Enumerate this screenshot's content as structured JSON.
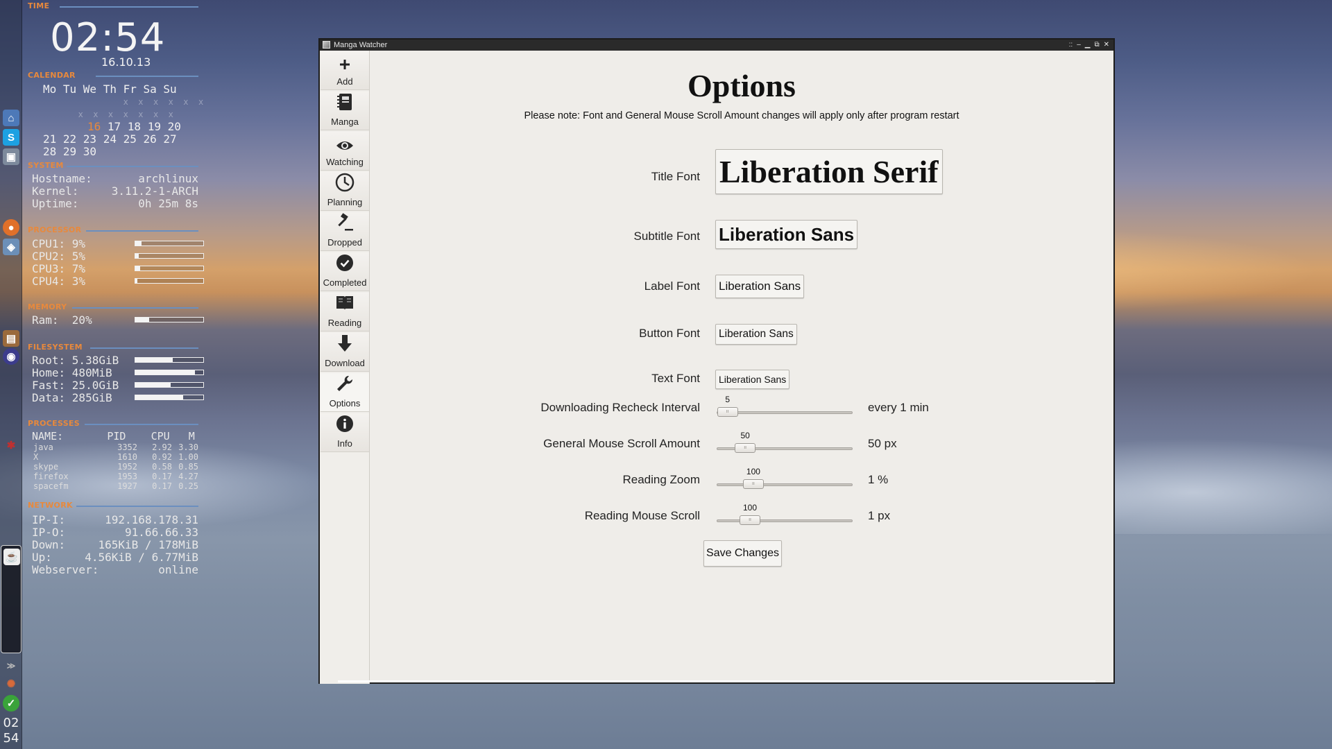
{
  "desktop": {
    "dock_clock": [
      "02",
      "54"
    ],
    "conky": {
      "time_section": "TIME",
      "time": "02:54",
      "date": "16.10.13",
      "calendar_section": "CALENDAR",
      "weekdays": "Mo Tu We Th Fr Sa Su",
      "cal_rows": [
        {
          "dim": "                x  x  x  x  x  x",
          "text": ""
        },
        {
          "dim": "       x  x  x  x  x  x  x",
          "text": ""
        }
      ],
      "cal_week3_today": "16",
      "cal_week3_rest": " 17 18 19 20",
      "cal_week4": "21 22 23 24 25 26 27",
      "cal_week5": "28 29 30",
      "system_section": "SYSTEM",
      "system": [
        {
          "k": "Hostname:",
          "v": "archlinux"
        },
        {
          "k": "Kernel:",
          "v": "3.11.2-1-ARCH"
        },
        {
          "k": "Uptime:",
          "v": "0h 25m 8s"
        }
      ],
      "processor_section": "PROCESSOR",
      "cpus": [
        {
          "label": "CPU1: 9%",
          "level": 0.09
        },
        {
          "label": "CPU2: 5%",
          "level": 0.05
        },
        {
          "label": "CPU3: 7%",
          "level": 0.07
        },
        {
          "label": "CPU4: 3%",
          "level": 0.03
        }
      ],
      "memory_section": "MEMORY",
      "ram": {
        "label": "Ram:  20%",
        "level": 0.2
      },
      "filesystem_section": "FILESYSTEM",
      "filesystems": [
        {
          "label": "Root: 5.38GiB",
          "level": 0.55
        },
        {
          "label": "Home: 480MiB",
          "level": 0.88
        },
        {
          "label": "Fast: 25.0GiB",
          "level": 0.52
        },
        {
          "label": "Data: 285GiB",
          "level": 0.7
        }
      ],
      "processes_section": "PROCESSES",
      "proc_header": "NAME:       PID    CPU   M",
      "processes": [
        {
          "name": "java",
          "pid": "3352",
          "cpu": "2.92",
          "mem": "3.30"
        },
        {
          "name": "X",
          "pid": "1610",
          "cpu": "0.92",
          "mem": "1.00"
        },
        {
          "name": "skype",
          "pid": "1952",
          "cpu": "0.58",
          "mem": "0.85"
        },
        {
          "name": "firefox",
          "pid": "1953",
          "cpu": "0.17",
          "mem": "4.27"
        },
        {
          "name": "spacefm",
          "pid": "1927",
          "cpu": "0.17",
          "mem": "0.25"
        }
      ],
      "network_section": "NETWORK",
      "network": [
        {
          "k": "IP-I:",
          "v": "192.168.178.31"
        },
        {
          "k": "IP-O:",
          "v": "91.66.66.33"
        },
        {
          "k": "Down:",
          "v": "165KiB / 178MiB"
        },
        {
          "k": "Up:",
          "v": "4.56KiB / 6.77MiB"
        },
        {
          "k": "Webserver:",
          "v": "online"
        }
      ]
    }
  },
  "window": {
    "title": "Manga Watcher",
    "controls": [
      "::",
      "–",
      "▁",
      "⧉",
      "✕"
    ]
  },
  "sidebar": {
    "items": [
      {
        "label": "Add",
        "icon": "plus-icon"
      },
      {
        "label": "Manga",
        "icon": "notebook-icon"
      },
      {
        "label": "Watching",
        "icon": "eye-icon"
      },
      {
        "label": "Planning",
        "icon": "clock-icon"
      },
      {
        "label": "Dropped",
        "icon": "gavel-icon"
      },
      {
        "label": "Completed",
        "icon": "checkmark-icon"
      },
      {
        "label": "Reading",
        "icon": "book-icon"
      },
      {
        "label": "Download",
        "icon": "download-arrow-icon"
      },
      {
        "label": "Options",
        "icon": "wrench-icon",
        "active": true
      },
      {
        "label": "Info",
        "icon": "info-icon"
      }
    ]
  },
  "options": {
    "title": "Options",
    "note": "Please note: Font and General Mouse Scroll Amount changes will apply only after program restart",
    "fonts": [
      {
        "label": "Title Font",
        "value": "Liberation Serif"
      },
      {
        "label": "Subtitle Font",
        "value": "Liberation Sans"
      },
      {
        "label": "Label Font",
        "value": "Liberation Sans"
      },
      {
        "label": "Button Font",
        "value": "Liberation Sans"
      },
      {
        "label": "Text Font",
        "value": "Liberation Sans"
      }
    ],
    "sliders": [
      {
        "label": "Downloading Recheck Interval",
        "value": "5",
        "level": 0.08,
        "output": "every 1 min"
      },
      {
        "label": "General Mouse Scroll Amount",
        "value": "50",
        "level": 0.21,
        "output": "50 px"
      },
      {
        "label": "Reading Zoom",
        "value": "100",
        "level": 0.27,
        "output": "1 %"
      },
      {
        "label": "Reading Mouse Scroll",
        "value": "100",
        "level": 0.245,
        "output": "1 px"
      }
    ],
    "save_label": "Save Changes"
  }
}
